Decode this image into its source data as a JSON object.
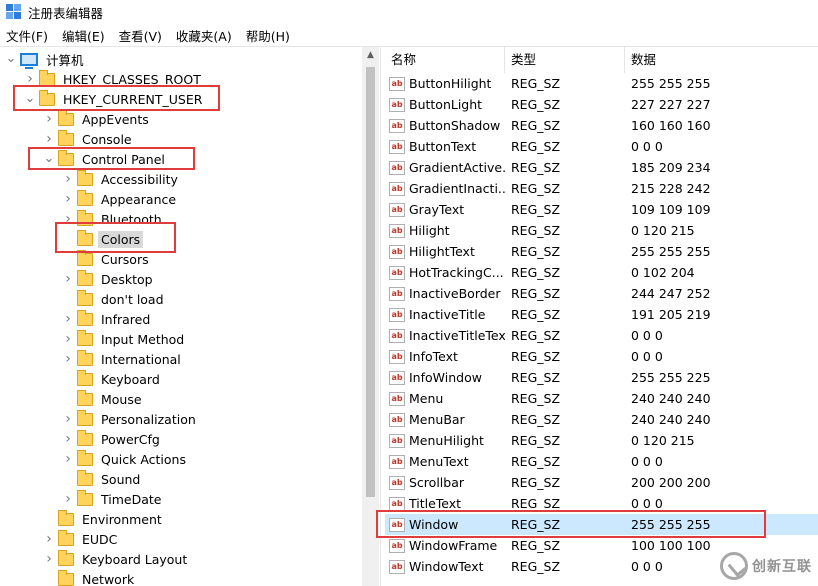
{
  "window": {
    "title": "注册表编辑器"
  },
  "menu": [
    "文件(F)",
    "编辑(E)",
    "查看(V)",
    "收藏夹(A)",
    "帮助(H)"
  ],
  "tree": [
    {
      "label": "计算机",
      "level": 0,
      "expander": "open",
      "icon": "computer-icon"
    },
    {
      "label": "HKEY_CLASSES_ROOT",
      "level": 1,
      "expander": "closed",
      "icon": "folder-icon"
    },
    {
      "label": "HKEY_CURRENT_USER",
      "level": 1,
      "expander": "open",
      "icon": "folder-icon"
    },
    {
      "label": "AppEvents",
      "level": 2,
      "expander": "closed",
      "icon": "folder-icon"
    },
    {
      "label": "Console",
      "level": 2,
      "expander": "closed",
      "icon": "folder-icon"
    },
    {
      "label": "Control Panel",
      "level": 2,
      "expander": "open",
      "icon": "folder-icon"
    },
    {
      "label": "Accessibility",
      "level": 3,
      "expander": "closed",
      "icon": "folder-icon"
    },
    {
      "label": "Appearance",
      "level": 3,
      "expander": "closed",
      "icon": "folder-icon"
    },
    {
      "label": "Bluetooth",
      "level": 3,
      "expander": "closed",
      "icon": "folder-icon"
    },
    {
      "label": "Colors",
      "level": 3,
      "expander": "none",
      "icon": "folder-icon",
      "selected": true
    },
    {
      "label": "Cursors",
      "level": 3,
      "expander": "none",
      "icon": "folder-icon"
    },
    {
      "label": "Desktop",
      "level": 3,
      "expander": "closed",
      "icon": "folder-icon"
    },
    {
      "label": "don't load",
      "level": 3,
      "expander": "none",
      "icon": "folder-icon"
    },
    {
      "label": "Infrared",
      "level": 3,
      "expander": "closed",
      "icon": "folder-icon"
    },
    {
      "label": "Input Method",
      "level": 3,
      "expander": "closed",
      "icon": "folder-icon"
    },
    {
      "label": "International",
      "level": 3,
      "expander": "closed",
      "icon": "folder-icon"
    },
    {
      "label": "Keyboard",
      "level": 3,
      "expander": "none",
      "icon": "folder-icon"
    },
    {
      "label": "Mouse",
      "level": 3,
      "expander": "none",
      "icon": "folder-icon"
    },
    {
      "label": "Personalization",
      "level": 3,
      "expander": "closed",
      "icon": "folder-icon"
    },
    {
      "label": "PowerCfg",
      "level": 3,
      "expander": "closed",
      "icon": "folder-icon"
    },
    {
      "label": "Quick Actions",
      "level": 3,
      "expander": "closed",
      "icon": "folder-icon"
    },
    {
      "label": "Sound",
      "level": 3,
      "expander": "none",
      "icon": "folder-icon"
    },
    {
      "label": "TimeDate",
      "level": 3,
      "expander": "closed",
      "icon": "folder-icon"
    },
    {
      "label": "Environment",
      "level": 2,
      "expander": "none",
      "icon": "folder-icon"
    },
    {
      "label": "EUDC",
      "level": 2,
      "expander": "closed",
      "icon": "folder-icon"
    },
    {
      "label": "Keyboard Layout",
      "level": 2,
      "expander": "closed",
      "icon": "folder-icon"
    },
    {
      "label": "Network",
      "level": 2,
      "expander": "none",
      "icon": "folder-icon"
    }
  ],
  "list": {
    "columns": [
      "名称",
      "类型",
      "数据"
    ],
    "rows": [
      {
        "name": "ButtonHilight",
        "type": "REG_SZ",
        "data": "255 255 255"
      },
      {
        "name": "ButtonLight",
        "type": "REG_SZ",
        "data": "227 227 227"
      },
      {
        "name": "ButtonShadow",
        "type": "REG_SZ",
        "data": "160 160 160"
      },
      {
        "name": "ButtonText",
        "type": "REG_SZ",
        "data": "0 0 0"
      },
      {
        "name": "GradientActive...",
        "type": "REG_SZ",
        "data": "185 209 234"
      },
      {
        "name": "GradientInacti...",
        "type": "REG_SZ",
        "data": "215 228 242"
      },
      {
        "name": "GrayText",
        "type": "REG_SZ",
        "data": "109 109 109"
      },
      {
        "name": "Hilight",
        "type": "REG_SZ",
        "data": "0 120 215"
      },
      {
        "name": "HilightText",
        "type": "REG_SZ",
        "data": "255 255 255"
      },
      {
        "name": "HotTrackingC...",
        "type": "REG_SZ",
        "data": "0 102 204"
      },
      {
        "name": "InactiveBorder",
        "type": "REG_SZ",
        "data": "244 247 252"
      },
      {
        "name": "InactiveTitle",
        "type": "REG_SZ",
        "data": "191 205 219"
      },
      {
        "name": "InactiveTitleText",
        "type": "REG_SZ",
        "data": "0 0 0"
      },
      {
        "name": "InfoText",
        "type": "REG_SZ",
        "data": "0 0 0"
      },
      {
        "name": "InfoWindow",
        "type": "REG_SZ",
        "data": "255 255 225"
      },
      {
        "name": "Menu",
        "type": "REG_SZ",
        "data": "240 240 240"
      },
      {
        "name": "MenuBar",
        "type": "REG_SZ",
        "data": "240 240 240"
      },
      {
        "name": "MenuHilight",
        "type": "REG_SZ",
        "data": "0 120 215"
      },
      {
        "name": "MenuText",
        "type": "REG_SZ",
        "data": "0 0 0"
      },
      {
        "name": "Scrollbar",
        "type": "REG_SZ",
        "data": "200 200 200"
      },
      {
        "name": "TitleText",
        "type": "REG_SZ",
        "data": "0 0 0"
      },
      {
        "name": "Window",
        "type": "REG_SZ",
        "data": "255 255 255",
        "selected": true
      },
      {
        "name": "WindowFrame",
        "type": "REG_SZ",
        "data": "100 100 100"
      },
      {
        "name": "WindowText",
        "type": "REG_SZ",
        "data": "0 0 0"
      }
    ]
  },
  "value_icon": "ab-string-icon",
  "colors": {
    "highlight_box": "#e03c3c",
    "selected_row": "#cce8ff",
    "folder": "#ffd35c"
  },
  "watermark": {
    "text": "创新互联"
  }
}
